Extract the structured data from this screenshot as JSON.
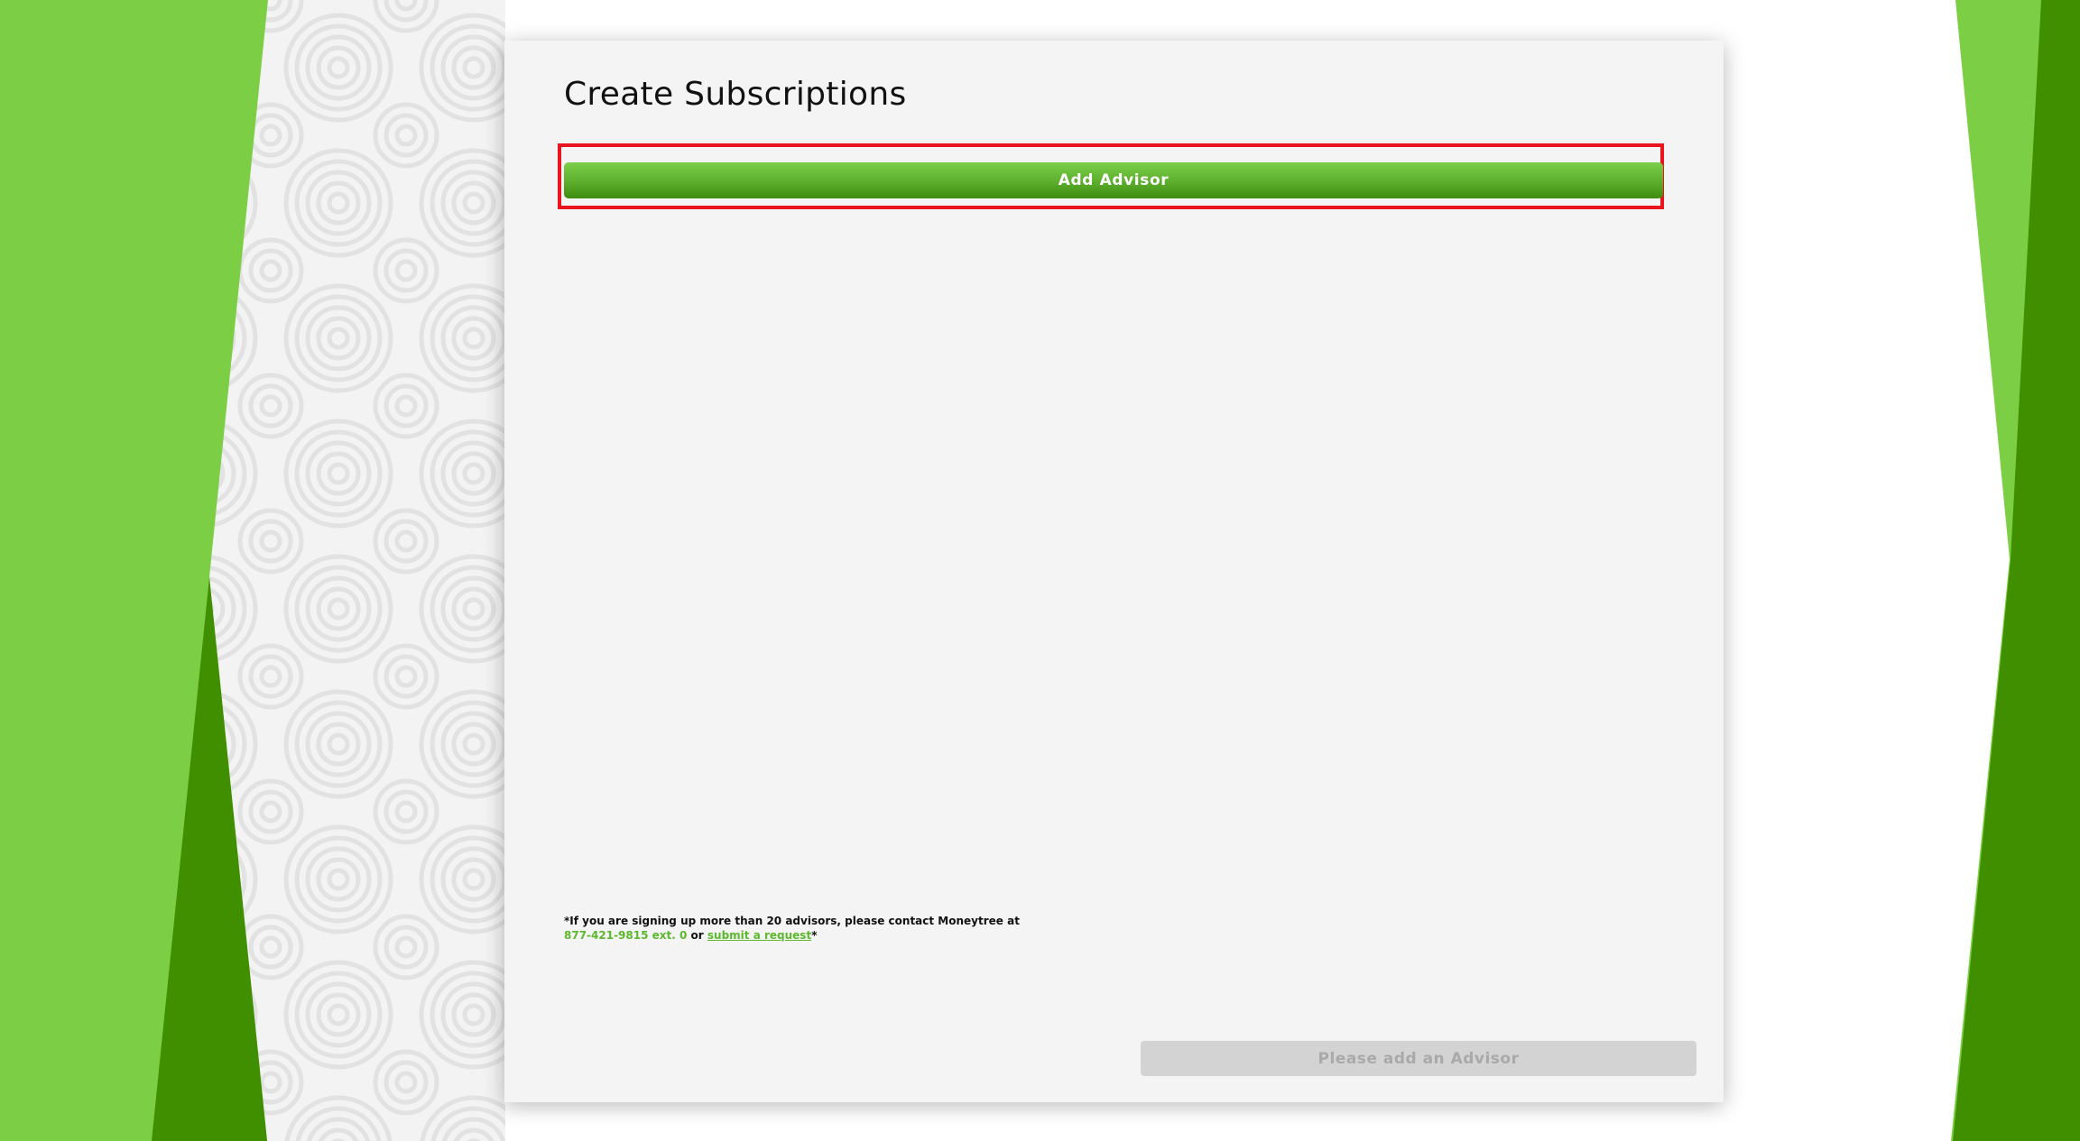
{
  "page": {
    "title": "Create Subscriptions"
  },
  "actions": {
    "add_advisor_label": "Add Advisor",
    "submit_label": "Please add an Advisor",
    "submit_enabled": false
  },
  "footnote": {
    "prefix": "*If you are signing up more than 20 advisors, please contact Moneytree at",
    "phone": "877-421-9815 ext. 0",
    "connector": "or",
    "link_label": "submit a request",
    "suffix": "*"
  },
  "colors": {
    "brand_green_light": "#7ccf45",
    "brand_green_dark": "#3f8f00",
    "highlight_red": "#e8141f",
    "card_background": "#f4f4f4",
    "disabled_button": "#d3d3d3"
  }
}
